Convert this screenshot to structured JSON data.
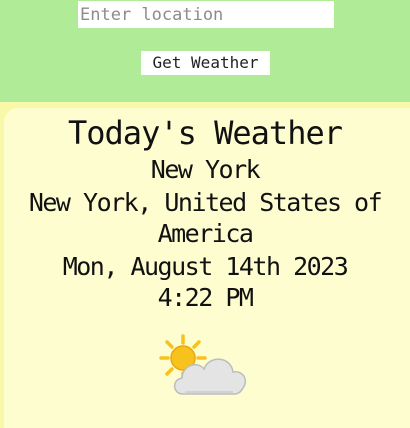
{
  "search": {
    "placeholder": "Enter location",
    "value": "",
    "button_label": "Get Weather"
  },
  "weather": {
    "title": "Today's Weather",
    "city": "New York",
    "region": "New York, United States of America",
    "date": "Mon, August 14th 2023",
    "time": "4:22 PM",
    "condition_icon": "partly-cloudy-icon"
  },
  "colors": {
    "header_background": "#b0ec98",
    "page_background": "#f8f8a8",
    "card_background": "#fdfdd0",
    "sun": "#f7c21c",
    "cloud": "#e4e4e4"
  }
}
